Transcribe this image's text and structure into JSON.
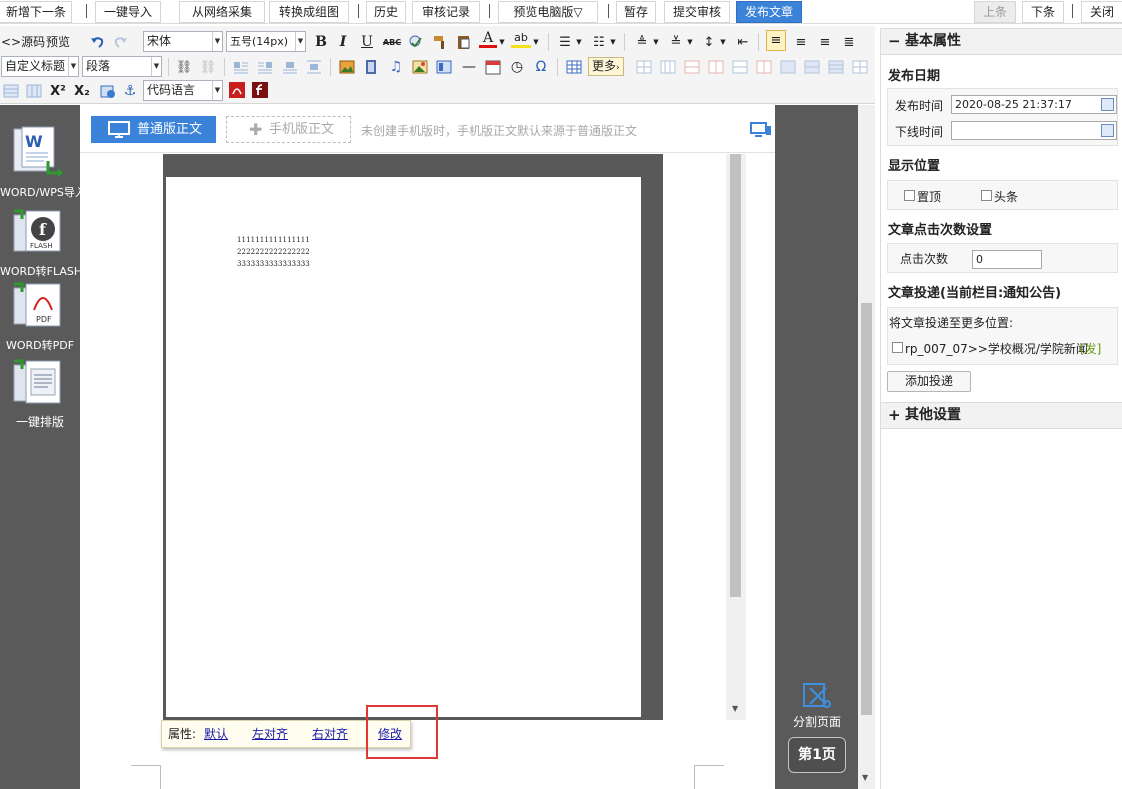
{
  "topbar": {
    "buttons": {
      "new_next": "新增下一条",
      "one_click_import": "一键导入",
      "web_collect": "从网络采集",
      "to_gallery": "转换成组图",
      "history": "历史",
      "review_record": "审核记录",
      "preview_pc": "预览电脑版▽",
      "save_draft": "暂存",
      "submit_review": "提交审核",
      "publish": "发布文章",
      "prev": "上条",
      "next": "下条",
      "close": "关闭"
    }
  },
  "toolbar": {
    "source": "<>源码",
    "preview": "预览",
    "font_family": "宋体",
    "font_size": "五号(14px)",
    "custom_heading": "自定义标题",
    "paragraph": "段落",
    "more": "更多",
    "code_language": "代码语言"
  },
  "leftbar": {
    "tools": {
      "word_import": "WORD/WPS导入",
      "word_flash": "WORD转FLASH",
      "word_pdf": "WORD转PDF",
      "one_click_layout": "一键排版"
    }
  },
  "editor": {
    "tab_normal": "普通版正文",
    "tab_mobile": "手机版正文",
    "mobile_hint": "未创建手机版时，手机版正文默认来源于普通版正文",
    "content_lines": [
      "1111111111111111",
      "2222222222222222",
      "3333333333333333"
    ],
    "attr_bar": {
      "label": "属性:",
      "default": "默认",
      "align_left": "左对齐",
      "align_right": "右对齐",
      "modify": "修改"
    }
  },
  "gutter": {
    "split_page": "分割页面",
    "page_button": "第1页"
  },
  "panel": {
    "basic_props": "基本属性",
    "publish_date_title": "发布日期",
    "publish_time_label": "发布时间",
    "publish_time_value": "2020-08-25 21:37:17",
    "offline_time_label": "下线时间",
    "offline_time_value": "",
    "display_position_title": "显示位置",
    "pin_top": "置顶",
    "headline": "头条",
    "click_count_title": "文章点击次数设置",
    "click_count_label": "点击次数",
    "click_count_value": "0",
    "delivery_title": "文章投递(当前栏目:通知公告)",
    "delivery_more_label": "将文章投递至更多位置:",
    "delivery_item": "rp_007_07>>学校概况/学院新闻",
    "delivery_item_tag": "[发]",
    "add_delivery": "添加投递",
    "other_settings": "其他设置"
  }
}
